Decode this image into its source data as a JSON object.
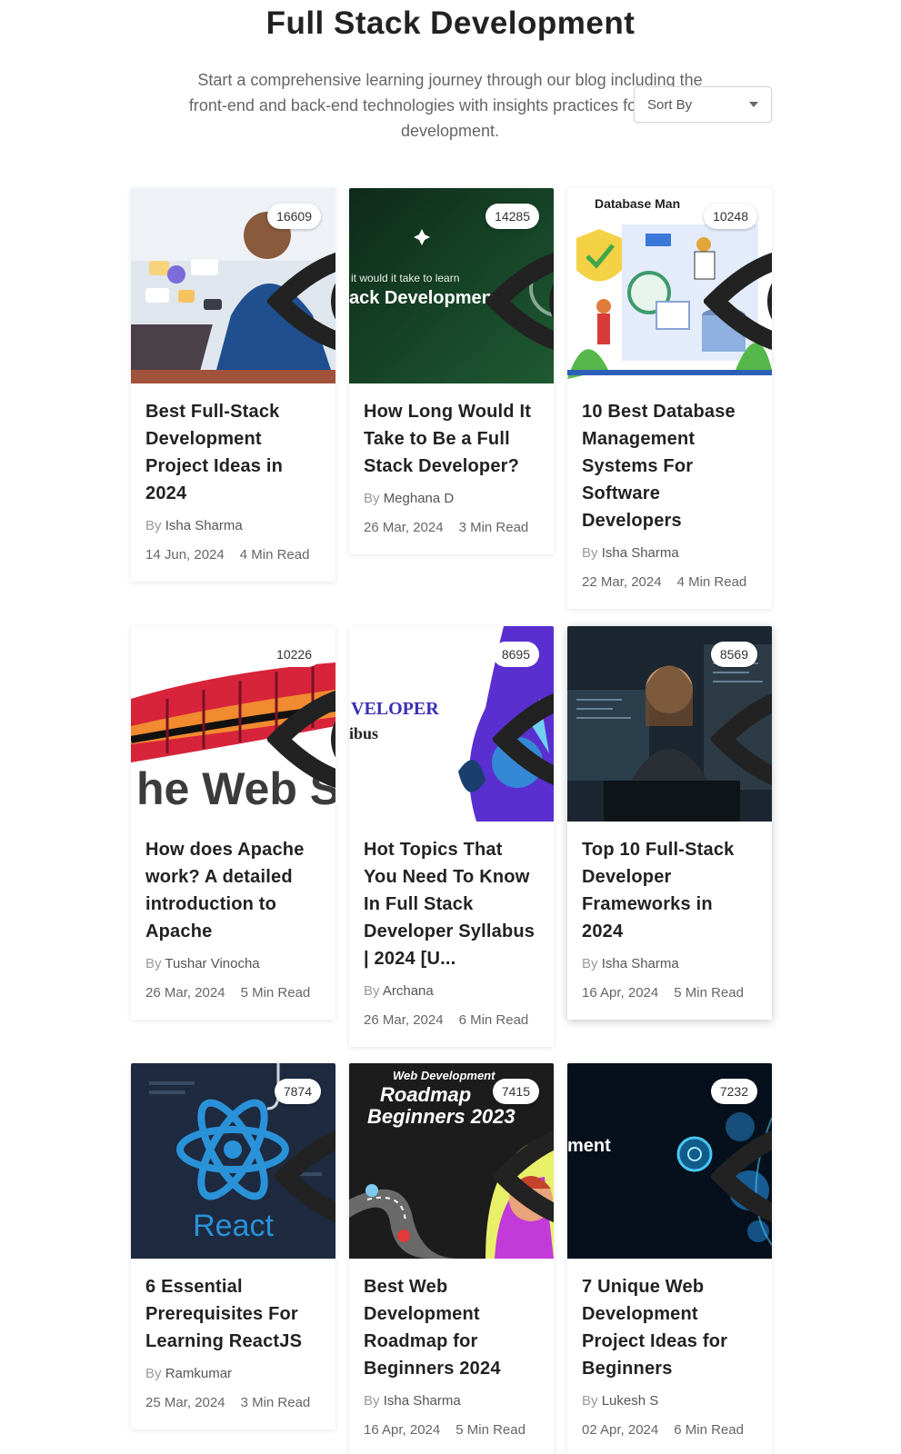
{
  "header": {
    "title": "Full Stack Development",
    "intro": "Start a comprehensive learning journey through our blog including the front-end and back-end technologies with insights practices for full-stack development.",
    "sort_label": "Sort By"
  },
  "cards": [
    {
      "views": "16609",
      "title": "Best Full-Stack Development Project Ideas in 2024",
      "by": "By",
      "author": "Isha Sharma",
      "date": "14 Jun, 2024",
      "read": "4 Min Read"
    },
    {
      "views": "14285",
      "title": "How Long Would It Take to Be a Full Stack Developer?",
      "by": "By",
      "author": "Meghana D",
      "date": "26 Mar, 2024",
      "read": "3 Min Read",
      "thumb_text_1": "it would it take to learn",
      "thumb_text_2": "ack Development?"
    },
    {
      "views": "10248",
      "title": "10 Best Database Management Systems For Software Developers",
      "by": "By",
      "author": "Isha Sharma",
      "date": "22 Mar, 2024",
      "read": "4 Min Read",
      "thumb_text_1": "Database Man"
    },
    {
      "views": "10226",
      "title": "How does Apache work? A detailed introduction to Apache",
      "by": "By",
      "author": "Tushar Vinocha",
      "date": "26 Mar, 2024",
      "read": "5 Min Read",
      "thumb_text_1": "he Web S"
    },
    {
      "views": "8695",
      "title": "Hot Topics That You Need To Know In Full Stack Developer Syllabus | 2024 [U...",
      "by": "By",
      "author": "Archana",
      "date": "26 Mar, 2024",
      "read": "6 Min Read",
      "thumb_text_1": "VELOPER",
      "thumb_text_2": "ibus"
    },
    {
      "views": "8569",
      "title": "Top 10 Full-Stack Developer Frameworks in 2024",
      "by": "By",
      "author": "Isha Sharma",
      "date": "16 Apr, 2024",
      "read": "5 Min Read"
    },
    {
      "views": "7874",
      "title": "6 Essential Prerequisites For Learning ReactJS",
      "by": "By",
      "author": "Ramkumar",
      "date": "25 Mar, 2024",
      "read": "3 Min Read",
      "thumb_text_1": "React"
    },
    {
      "views": "7415",
      "title": "Best Web Development Roadmap for Beginners 2024",
      "by": "By",
      "author": "Isha Sharma",
      "date": "16 Apr, 2024",
      "read": "5 Min Read",
      "thumb_text_1": "Web Development",
      "thumb_text_2": "Roadmap",
      "thumb_text_3": "Beginners 2023"
    },
    {
      "views": "7232",
      "title": "7 Unique Web Development Project Ideas for Beginners",
      "by": "By",
      "author": "Lukesh S",
      "date": "02 Apr, 2024",
      "read": "6 Min Read",
      "thumb_text_1": "ment"
    }
  ]
}
